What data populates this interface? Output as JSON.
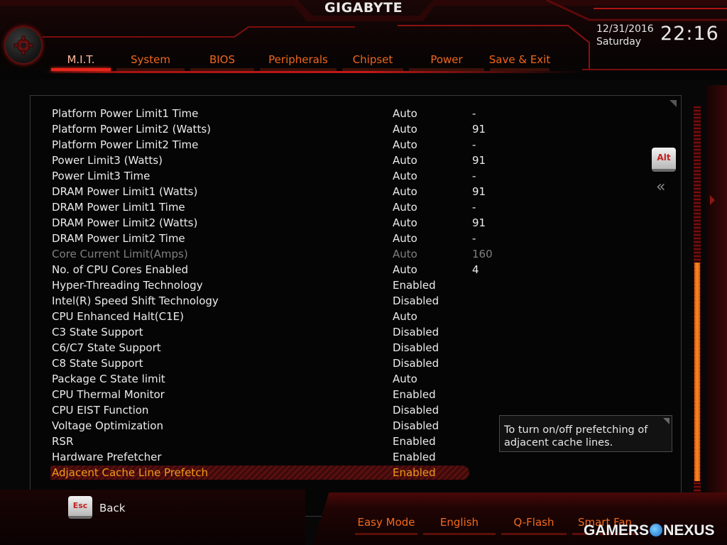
{
  "brand": "GIGABYTE",
  "datetime": {
    "date": "12/31/2016",
    "day": "Saturday",
    "time": "22:16"
  },
  "tabs": [
    {
      "label": "M.I.T.",
      "active": true
    },
    {
      "label": "System",
      "active": false
    },
    {
      "label": "BIOS",
      "active": false
    },
    {
      "label": "Peripherals",
      "active": false
    },
    {
      "label": "Chipset",
      "active": false
    },
    {
      "label": "Power",
      "active": false
    },
    {
      "label": "Save & Exit",
      "active": false
    }
  ],
  "settings": [
    {
      "name": "Platform Power Limit1 Time",
      "value": "Auto",
      "extra": "-"
    },
    {
      "name": "Platform Power Limit2 (Watts)",
      "value": "Auto",
      "extra": "91"
    },
    {
      "name": "Platform Power Limit2 Time",
      "value": "Auto",
      "extra": "-"
    },
    {
      "name": "Power Limit3 (Watts)",
      "value": "Auto",
      "extra": "91"
    },
    {
      "name": "Power Limit3 Time",
      "value": "Auto",
      "extra": "-"
    },
    {
      "name": "DRAM Power Limit1 (Watts)",
      "value": "Auto",
      "extra": "91"
    },
    {
      "name": "DRAM Power Limit1 Time",
      "value": "Auto",
      "extra": "-"
    },
    {
      "name": "DRAM Power Limit2 (Watts)",
      "value": "Auto",
      "extra": "91"
    },
    {
      "name": "DRAM Power Limit2 Time",
      "value": "Auto",
      "extra": "-"
    },
    {
      "name": "Core Current Limit(Amps)",
      "value": "Auto",
      "extra": "160",
      "state": "disabled"
    },
    {
      "name": "No. of CPU Cores Enabled",
      "value": "Auto",
      "extra": "4"
    },
    {
      "name": "Hyper-Threading Technology",
      "value": "Enabled",
      "extra": ""
    },
    {
      "name": "Intel(R) Speed Shift Technology",
      "value": "Disabled",
      "extra": ""
    },
    {
      "name": "CPU Enhanced Halt(C1E)",
      "value": "Auto",
      "extra": ""
    },
    {
      "name": "C3 State Support",
      "value": "Disabled",
      "extra": ""
    },
    {
      "name": "C6/C7 State Support",
      "value": "Disabled",
      "extra": ""
    },
    {
      "name": "C8 State Support",
      "value": "Disabled",
      "extra": ""
    },
    {
      "name": "Package C State limit",
      "value": "Auto",
      "extra": ""
    },
    {
      "name": "CPU Thermal Monitor",
      "value": "Enabled",
      "extra": ""
    },
    {
      "name": "CPU EIST Function",
      "value": "Disabled",
      "extra": ""
    },
    {
      "name": "Voltage Optimization",
      "value": "Disabled",
      "extra": ""
    },
    {
      "name": "RSR",
      "value": "Enabled",
      "extra": ""
    },
    {
      "name": "Hardware Prefetcher",
      "value": "Enabled",
      "extra": ""
    },
    {
      "name": "Adjacent Cache Line Prefetch",
      "value": "Enabled",
      "extra": "",
      "state": "selected"
    }
  ],
  "help_text": "To turn on/off prefetching of adjacent cache lines.",
  "side_keys": {
    "alt_label": "Alt"
  },
  "back": {
    "key_label": "Esc",
    "label": "Back"
  },
  "bottom_menu": [
    "Easy Mode",
    "English",
    "Q-Flash",
    "Smart Fan"
  ],
  "watermark": {
    "left": "GAMERS",
    "right": "NEXUS"
  },
  "scroll": {
    "position_fraction": 0.4,
    "visible_fraction": 0.55
  },
  "colors": {
    "accent_orange": "#f0661c",
    "selected_text": "#f29a18",
    "tab_active_underline": "#e8251a",
    "frame_red": "#a81212"
  },
  "icons": {
    "settings": "gear-icon",
    "collapse": "double-chevron-left-icon",
    "scroll_down": "triangle-down-icon"
  }
}
